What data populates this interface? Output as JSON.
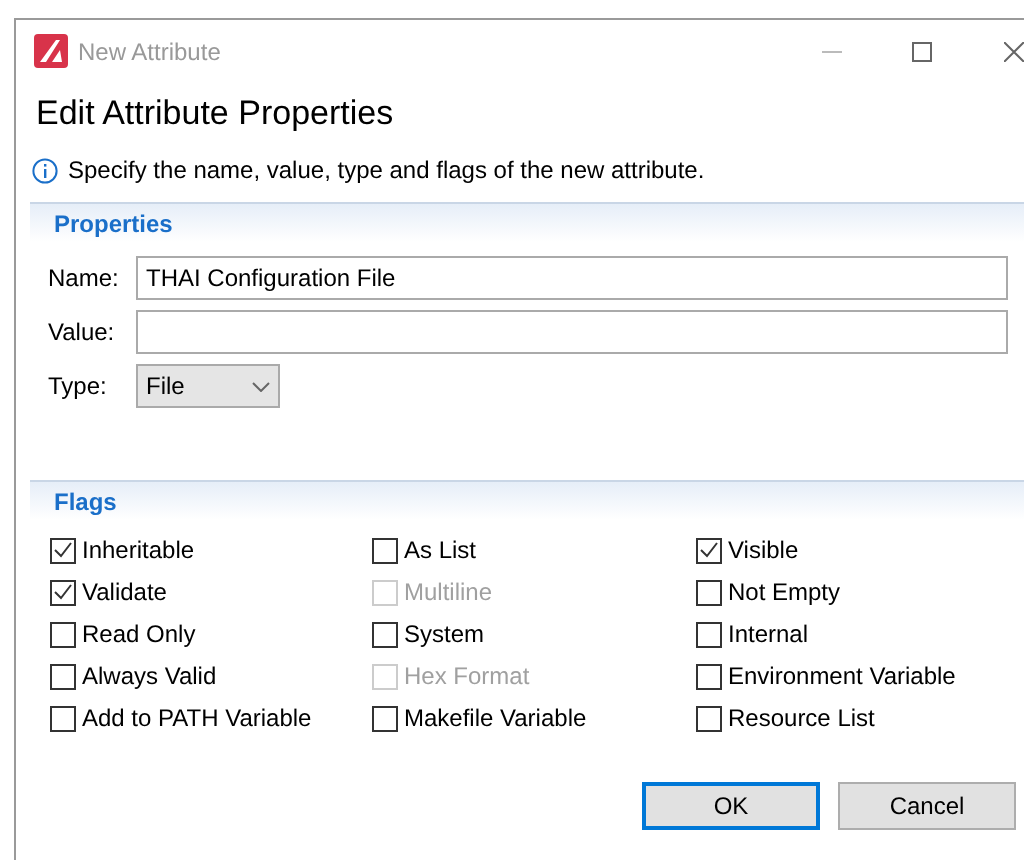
{
  "window": {
    "title": "New Attribute"
  },
  "heading": "Edit Attribute Properties",
  "info": "Specify the name, value, type and flags of the new attribute.",
  "properties": {
    "title": "Properties",
    "fields": [
      {
        "label": "Name:",
        "kind": "text",
        "value": "THAI Configuration File"
      },
      {
        "label": "Value:",
        "kind": "text"
      },
      {
        "label": "Type:",
        "kind": "select",
        "value": "File"
      }
    ]
  },
  "flags": {
    "title": "Flags",
    "items": [
      {
        "label": "Inheritable",
        "checked": true,
        "disabled": false
      },
      {
        "label": "As List",
        "checked": false,
        "disabled": false
      },
      {
        "label": "Visible",
        "checked": true,
        "disabled": false
      },
      {
        "label": "Validate",
        "checked": true,
        "disabled": false
      },
      {
        "label": "Multiline",
        "checked": false,
        "disabled": true
      },
      {
        "label": "Not Empty",
        "checked": false,
        "disabled": false
      },
      {
        "label": "Read Only",
        "checked": false,
        "disabled": false
      },
      {
        "label": "System",
        "checked": false,
        "disabled": false
      },
      {
        "label": "Internal",
        "checked": false,
        "disabled": false
      },
      {
        "label": "Always Valid",
        "checked": false,
        "disabled": false
      },
      {
        "label": "Hex Format",
        "checked": false,
        "disabled": true
      },
      {
        "label": "Environment Variable",
        "checked": false,
        "disabled": false
      },
      {
        "label": "Add to PATH Variable",
        "checked": false,
        "disabled": false
      },
      {
        "label": "Makefile Variable",
        "checked": false,
        "disabled": false
      },
      {
        "label": "Resource List",
        "checked": false,
        "disabled": false
      }
    ]
  },
  "buttons": [
    {
      "label": "OK",
      "selected": true
    },
    {
      "label": "Cancel",
      "selected": false
    }
  ]
}
